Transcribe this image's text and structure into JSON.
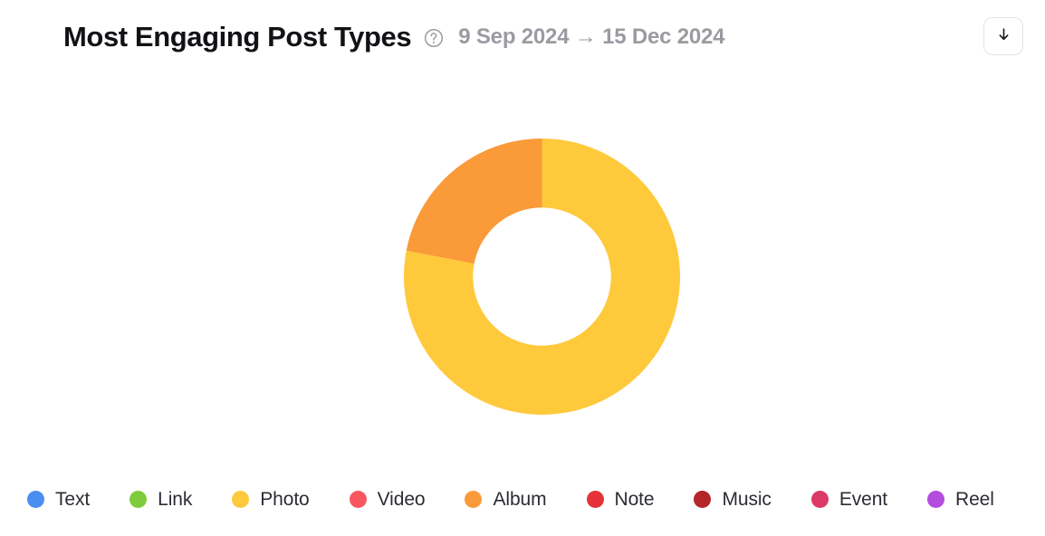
{
  "header": {
    "title": "Most Engaging Post Types",
    "help_icon": "question-mark-circle-icon",
    "date_range": "9 Sep 2024 → 15 Dec 2024",
    "date_start": "9 Sep 2024",
    "date_end": "15 Dec 2024",
    "download_icon": "download-arrow-icon",
    "download_label": "↓"
  },
  "colors": {
    "text": "#4a8ef0",
    "link": "#7ecc3c",
    "photo": "#ffc93c",
    "video": "#f9575f",
    "album": "#fa9a38",
    "note": "#e53238",
    "music": "#b4252c",
    "event": "#db3a68",
    "reel": "#b44ce0",
    "title": "#111215",
    "date": "#9a9ba1",
    "legend_text": "#2b2d33",
    "border": "#e3e4e8",
    "background": "#ffffff"
  },
  "legend": {
    "items": [
      {
        "label": "Text",
        "color": "#4a8ef0"
      },
      {
        "label": "Link",
        "color": "#7ecc3c"
      },
      {
        "label": "Photo",
        "color": "#ffc93c"
      },
      {
        "label": "Video",
        "color": "#f9575f"
      },
      {
        "label": "Album",
        "color": "#fa9a38"
      },
      {
        "label": "Note",
        "color": "#e53238"
      },
      {
        "label": "Music",
        "color": "#b4252c"
      },
      {
        "label": "Event",
        "color": "#db3a68"
      },
      {
        "label": "Reel",
        "color": "#b44ce0"
      }
    ]
  },
  "chart_data": {
    "type": "pie",
    "variant": "donut",
    "title": "Most Engaging Post Types",
    "categories": [
      "Text",
      "Link",
      "Photo",
      "Video",
      "Album",
      "Note",
      "Music",
      "Event",
      "Reel"
    ],
    "values": [
      0,
      0,
      78,
      0,
      22,
      0,
      0,
      0,
      0
    ],
    "unit": "percent",
    "colors": [
      "#4a8ef0",
      "#7ecc3c",
      "#ffc93c",
      "#f9575f",
      "#fa9a38",
      "#e53238",
      "#b4252c",
      "#db3a68",
      "#b44ce0"
    ],
    "start_angle_deg": 0,
    "direction": "clockwise",
    "inner_radius_ratio": 0.5,
    "legend_position": "bottom",
    "grid": false,
    "xlabel": "",
    "ylabel": ""
  }
}
